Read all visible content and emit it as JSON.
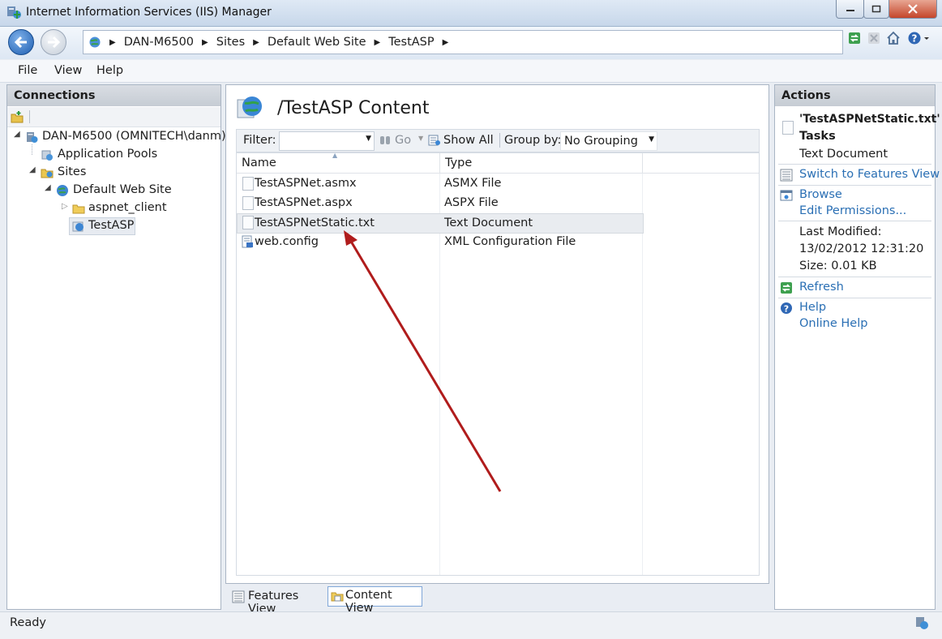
{
  "window": {
    "title": "Internet Information Services (IIS) Manager"
  },
  "address": {
    "segments": [
      "DAN-M6500",
      "Sites",
      "Default Web Site",
      "TestASP"
    ]
  },
  "menu": {
    "file": "File",
    "view": "View",
    "help": "Help"
  },
  "connections": {
    "header": "Connections",
    "tree": {
      "server": "DAN-M6500 (OMNITECH\\danm)",
      "app_pools": "Application Pools",
      "sites": "Sites",
      "default_site": "Default Web Site",
      "aspnet_client": "aspnet_client",
      "testasp": "TestASP"
    }
  },
  "content": {
    "title": "/TestASP Content",
    "filter_label": "Filter:",
    "go_label": "Go",
    "show_all_label": "Show All",
    "group_by_label": "Group by:",
    "group_by_value": "No Grouping",
    "columns": {
      "name": "Name",
      "type": "Type"
    },
    "rows": [
      {
        "name": "TestASPNet.asmx",
        "type": "ASMX File"
      },
      {
        "name": "TestASPNet.aspx",
        "type": "ASPX File"
      },
      {
        "name": "TestASPNetStatic.txt",
        "type": "Text Document"
      },
      {
        "name": "web.config",
        "type": "XML Configuration File"
      }
    ],
    "selected_row": 2,
    "tabs": {
      "features": "Features View",
      "content": "Content View"
    }
  },
  "actions": {
    "header": "Actions",
    "task_title": "'TestASPNetStatic.txt'",
    "task_sub": "Tasks",
    "task_type": "Text Document",
    "switch": "Switch to Features View",
    "browse": "Browse",
    "edit_perm": "Edit Permissions...",
    "last_modified_label": "Last Modified:",
    "last_modified_value": "13/02/2012 12:31:20",
    "size": "Size: 0.01 KB",
    "refresh": "Refresh",
    "help": "Help",
    "online_help": "Online Help"
  },
  "status": {
    "text": "Ready"
  },
  "colors": {
    "arrow": "#b01c1c",
    "link": "#2a6fb4",
    "selection": "#e6eaf0"
  },
  "icons": [
    "back-icon",
    "forward-icon",
    "globe-icon",
    "folder-icon",
    "file-icon",
    "refresh-icon",
    "help-icon",
    "home-icon"
  ]
}
